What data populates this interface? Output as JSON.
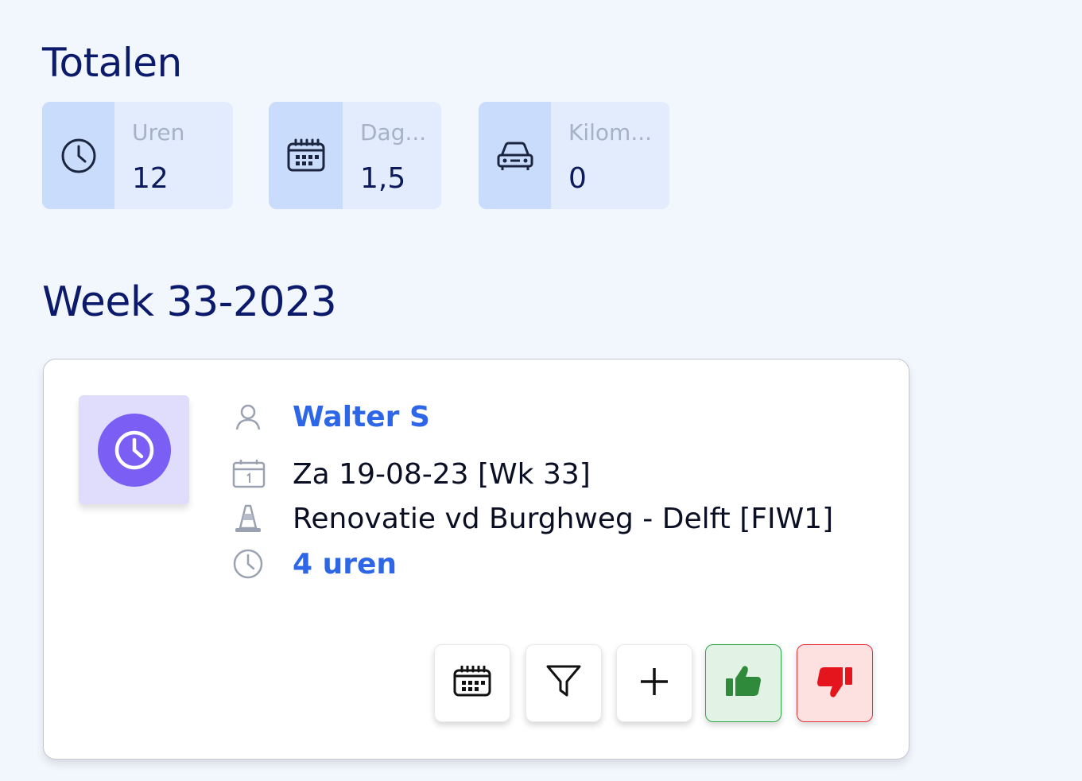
{
  "totals": {
    "title": "Totalen",
    "stats": [
      {
        "label": "Uren",
        "value": "12",
        "icon": "clock-icon"
      },
      {
        "label": "Dag...",
        "value": "1,5",
        "icon": "calendar-icon"
      },
      {
        "label": "Kilom...",
        "value": "0",
        "icon": "car-icon"
      }
    ]
  },
  "week": {
    "title": "Week 33-2023"
  },
  "entry": {
    "avatar_icon": "clock-icon",
    "employee": "Walter S",
    "date": "Za 19-08-23 [Wk 33]",
    "project": "Renovatie vd Burghweg - Delft [FIW1]",
    "hours": "4 uren"
  },
  "actions": [
    {
      "name": "calendar-button",
      "icon": "calendar-icon"
    },
    {
      "name": "filter-button",
      "icon": "filter-icon"
    },
    {
      "name": "add-button",
      "icon": "plus-icon"
    },
    {
      "name": "approve-button",
      "icon": "thumbs-up-icon"
    },
    {
      "name": "reject-button",
      "icon": "thumbs-down-icon"
    }
  ],
  "colors": {
    "accent": "#2d66e6",
    "avatar": "#7b5ef4",
    "approve": "#2fa84a",
    "reject": "#e8323a"
  }
}
